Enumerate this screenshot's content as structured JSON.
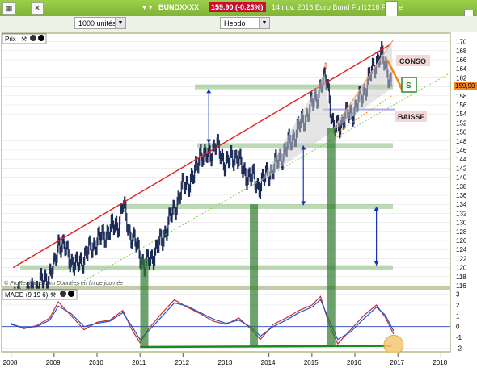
{
  "topbar": {
    "ticker": "BUNDXXXX",
    "last_price_badge": "159.90 (-0.23%)",
    "description": "14 nov. 2016 Euro Bund Full1216 Future"
  },
  "toolbar": {
    "quantity_select": "1000 unités",
    "period_select": "Hebdo"
  },
  "price_panel": {
    "label": "Prix",
    "current_price_tag": "159,90",
    "watermark": "© ProRealTime.com Données en fin de journée",
    "annotations": {
      "conso": "CONSO",
      "baisse": "BAISSE",
      "s": "S"
    }
  },
  "macd_panel": {
    "label": "MACD (9 19 6)"
  },
  "chart_data": [
    {
      "type": "line",
      "title": "Euro Bund Full1216 Future",
      "subtitle": "Hebdo",
      "x": [
        2008.0,
        2008.25,
        2008.5,
        2008.75,
        2009.0,
        2009.1,
        2009.25,
        2009.5,
        2009.75,
        2010.0,
        2010.25,
        2010.5,
        2010.6,
        2010.75,
        2011.0,
        2011.1,
        2011.25,
        2011.5,
        2011.75,
        2012.0,
        2012.25,
        2012.4,
        2012.5,
        2012.75,
        2013.0,
        2013.25,
        2013.4,
        2013.6,
        2013.75,
        2014.0,
        2014.25,
        2014.5,
        2014.75,
        2015.0,
        2015.2,
        2015.35,
        2015.5,
        2015.75,
        2016.0,
        2016.25,
        2016.5,
        2016.6,
        2016.75,
        2016.85
      ],
      "values": [
        114,
        113,
        115,
        117,
        120,
        126,
        124,
        120,
        123,
        126,
        128,
        130,
        134,
        128,
        123,
        120,
        122,
        126,
        132,
        138,
        140,
        146,
        144,
        147,
        143,
        145,
        141,
        140,
        138,
        141,
        144,
        148,
        152,
        156,
        160,
        162,
        150,
        153,
        155,
        160,
        166,
        167,
        164,
        160
      ],
      "xlim": [
        2007.8,
        2018.2
      ],
      "ylim": [
        116,
        171
      ],
      "x_ticks": [
        "2008",
        "2009",
        "2010",
        "2011",
        "2012",
        "2013",
        "2014",
        "2015",
        "2016",
        "2017",
        "2018"
      ],
      "y_ticks": [
        116,
        118,
        120,
        122,
        124,
        126,
        128,
        130,
        132,
        134,
        136,
        138,
        140,
        142,
        144,
        146,
        148,
        150,
        152,
        154,
        156,
        158,
        160,
        162,
        164,
        166,
        168,
        170
      ],
      "current_value": 159.9,
      "support_zones": [
        160,
        147,
        133.5,
        120
      ],
      "annotations": [
        "CONSO",
        "BAISSE",
        "S"
      ]
    },
    {
      "type": "line",
      "title": "MACD (9 19 6)",
      "x": [
        2008.0,
        2008.3,
        2008.6,
        2008.9,
        2009.1,
        2009.4,
        2009.7,
        2010.0,
        2010.3,
        2010.6,
        2010.8,
        2011.0,
        2011.2,
        2011.5,
        2011.8,
        2012.1,
        2012.4,
        2012.7,
        2013.0,
        2013.3,
        2013.6,
        2013.8,
        2014.1,
        2014.4,
        2014.7,
        2015.0,
        2015.2,
        2015.4,
        2015.6,
        2015.9,
        2016.2,
        2016.5,
        2016.7,
        2016.9
      ],
      "series": [
        {
          "name": "MACD",
          "values": [
            0.3,
            -0.2,
            0.1,
            0.8,
            2.3,
            1.0,
            -0.3,
            0.4,
            0.6,
            1.5,
            -0.2,
            -1.5,
            -0.2,
            1.2,
            2.5,
            1.8,
            1.2,
            0.5,
            0.2,
            0.8,
            -0.3,
            -1.2,
            0.2,
            0.8,
            1.5,
            2.0,
            2.8,
            0.2,
            -1.6,
            -0.3,
            1.0,
            2.0,
            0.9,
            -0.7
          ]
        },
        {
          "name": "Signal",
          "values": [
            0.2,
            -0.1,
            0.0,
            0.6,
            1.9,
            1.2,
            0.0,
            0.3,
            0.5,
            1.3,
            0.1,
            -1.2,
            -0.4,
            0.9,
            2.2,
            1.9,
            1.3,
            0.7,
            0.3,
            0.6,
            -0.1,
            -0.9,
            0.0,
            0.6,
            1.3,
            1.8,
            2.5,
            0.6,
            -1.2,
            -0.5,
            0.7,
            1.8,
            1.1,
            -0.4
          ]
        }
      ],
      "ylim": [
        -2.2,
        3.2
      ],
      "y_ticks": [
        3,
        2,
        1,
        0,
        -1,
        -2
      ]
    }
  ]
}
